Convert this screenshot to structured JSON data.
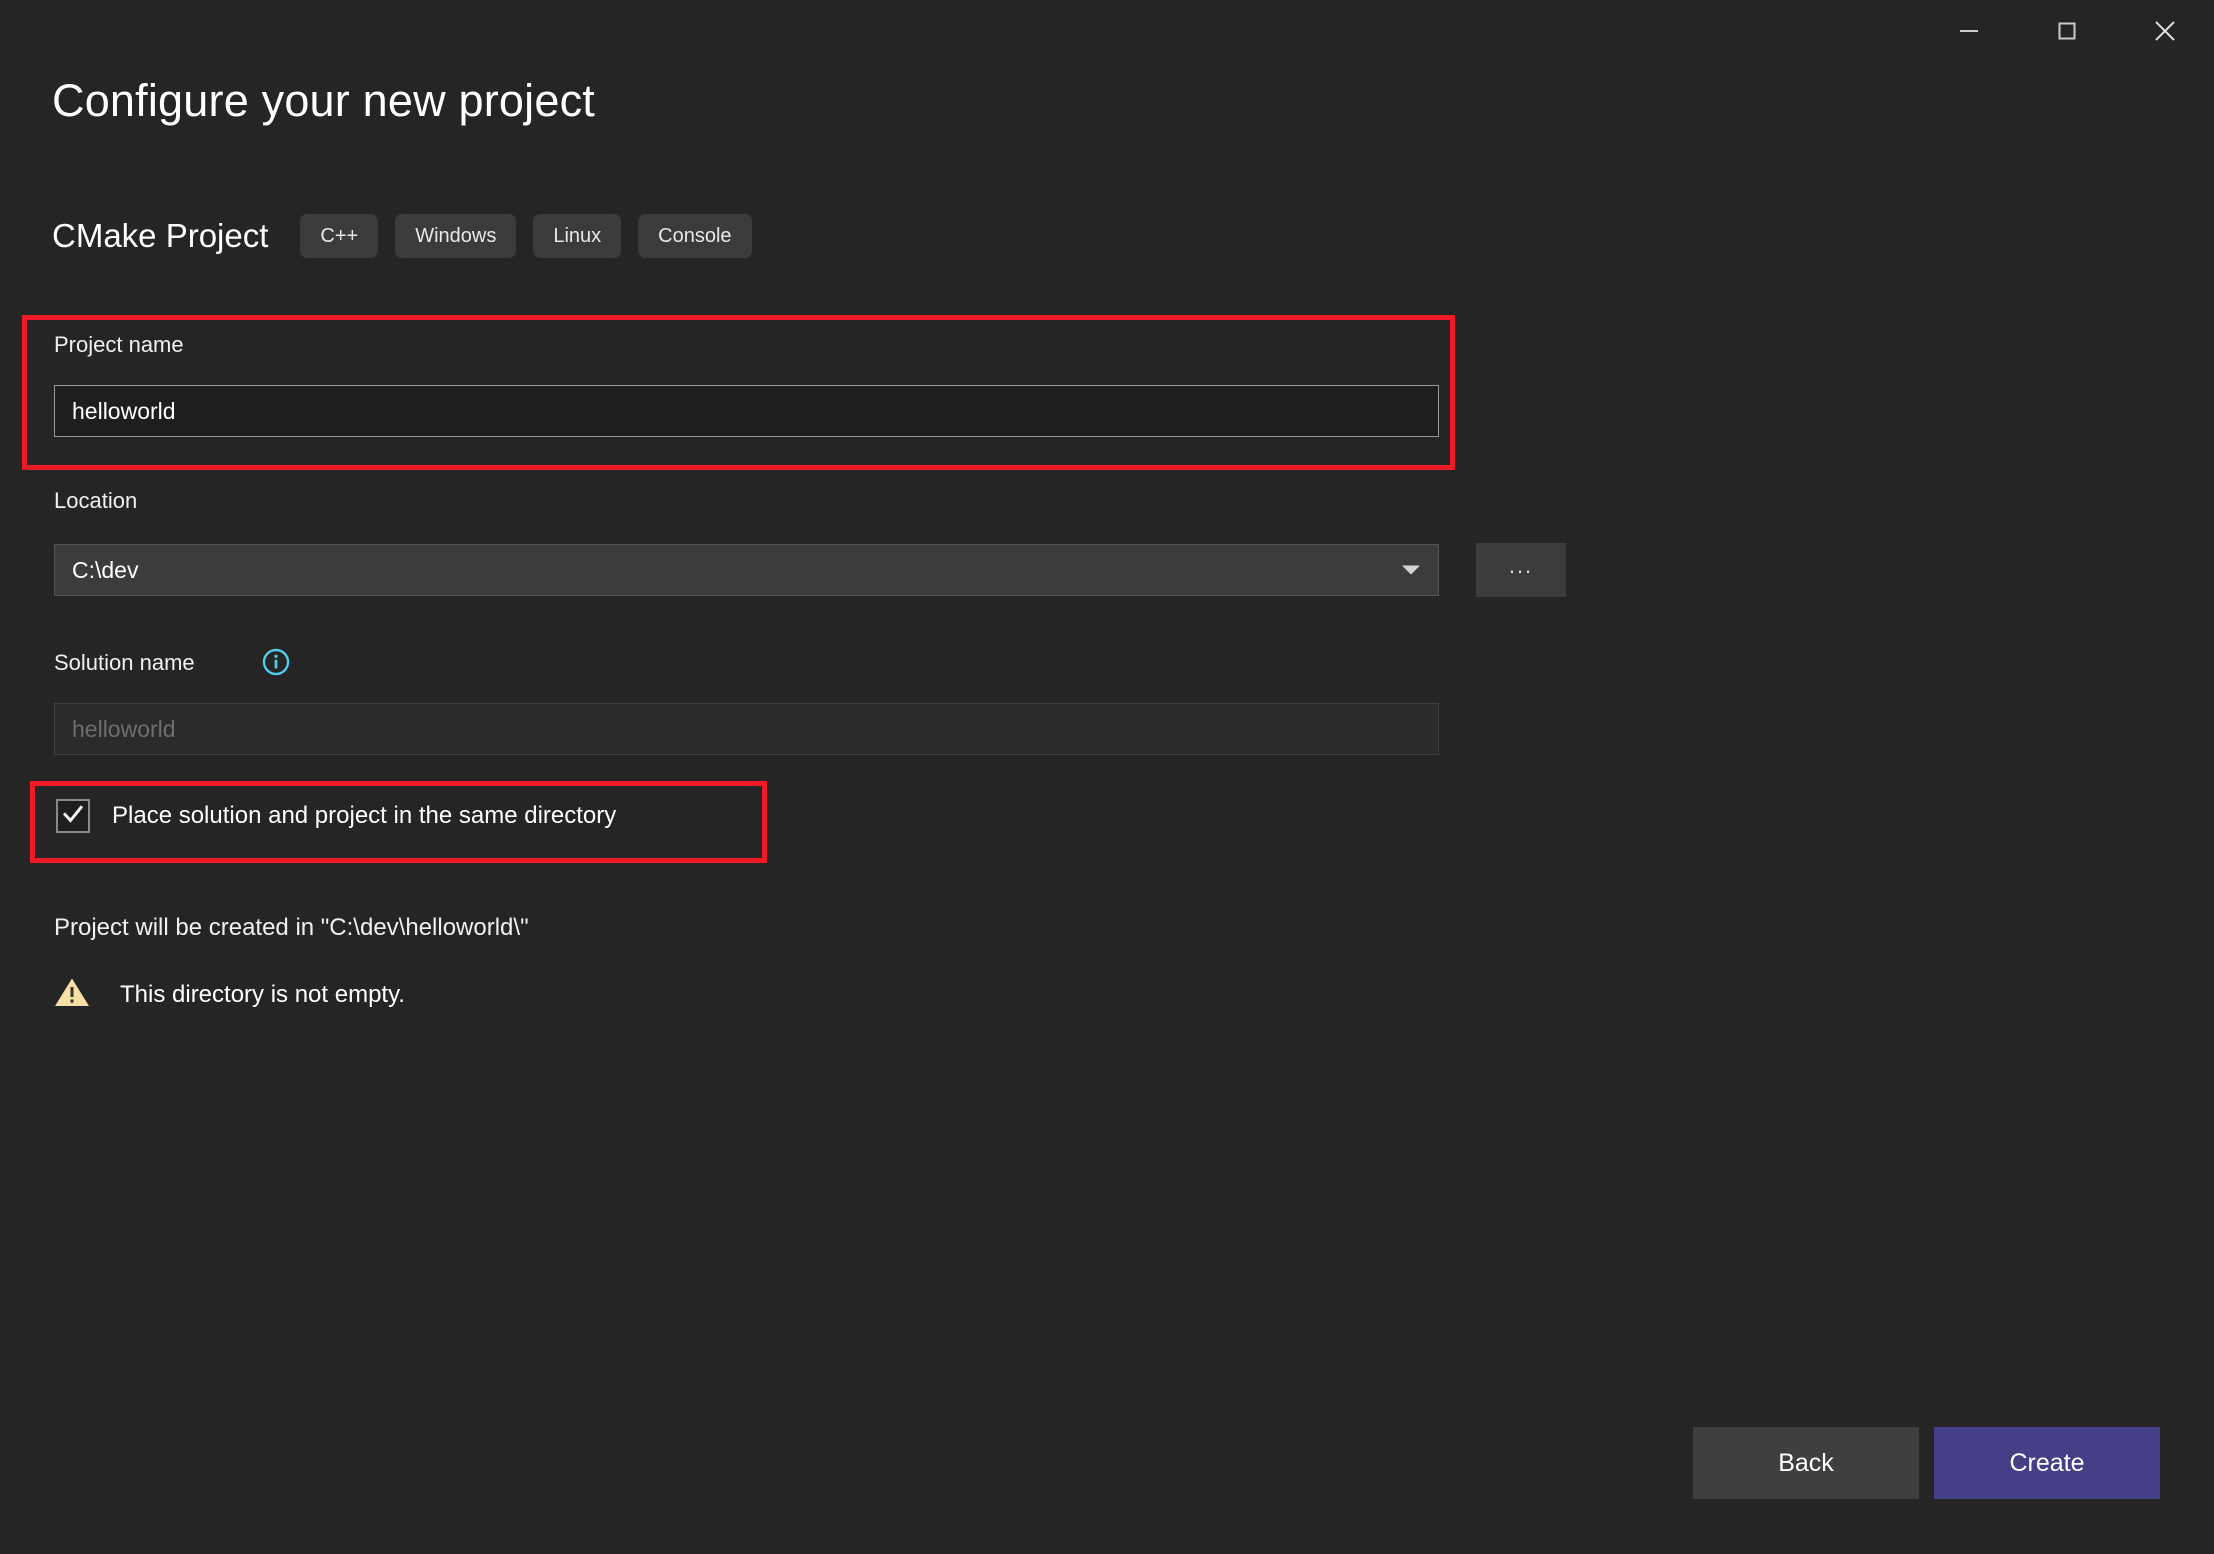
{
  "window": {
    "controls": [
      {
        "name": "minimize",
        "glyph": "minimize-icon"
      },
      {
        "name": "maximize",
        "glyph": "maximize-icon"
      },
      {
        "name": "close",
        "glyph": "close-icon"
      }
    ]
  },
  "header": {
    "title": "Configure your new project",
    "template_name": "CMake Project",
    "tags": [
      "C++",
      "Windows",
      "Linux",
      "Console"
    ]
  },
  "form": {
    "project_name": {
      "label": "Project name",
      "value": "helloworld"
    },
    "location": {
      "label": "Location",
      "value": "C:\\dev",
      "browse_label": "...",
      "caret": "chevron-down-icon"
    },
    "solution_name": {
      "label": "Solution name",
      "info_icon": "info-icon",
      "value": "helloworld",
      "disabled": true
    },
    "same_directory_checkbox": {
      "label": "Place solution and project in the same directory",
      "checked": true,
      "check_glyph": "check-icon"
    }
  },
  "status": {
    "created_in": "Project will be created in \"C:\\dev\\helloworld\\\"",
    "warning_icon": "warning-triangle-icon",
    "warning_text": "This directory is not empty."
  },
  "footer": {
    "back_label": "Back",
    "create_label": "Create"
  },
  "colors": {
    "background": "#252526",
    "accent_create": "#443f87",
    "annotation_red": "#ee1b26",
    "info_blue": "#4ec9e8",
    "warning_yellow": "#f7e0a8"
  }
}
